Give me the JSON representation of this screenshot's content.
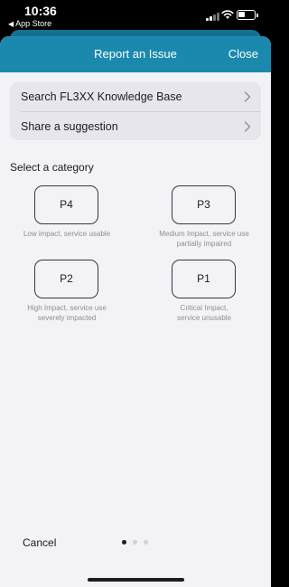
{
  "status_bar": {
    "time": "10:36",
    "back_app": "App Store",
    "icons": [
      "cellular-signal-icon",
      "wifi-icon",
      "battery-icon"
    ]
  },
  "nav": {
    "title": "Report an Issue",
    "close_label": "Close",
    "background_color": "#1a89ad"
  },
  "menu": {
    "items": [
      {
        "label": "Search FL3XX Knowledge Base",
        "icon": "chevron-right-icon"
      },
      {
        "label": "Share a suggestion",
        "icon": "chevron-right-icon"
      }
    ]
  },
  "category": {
    "heading": "Select a category",
    "options": [
      {
        "label": "P4",
        "description_line1": "Low impact, service usable",
        "description_line2": ""
      },
      {
        "label": "P3",
        "description_line1": "Medium Impact, service use",
        "description_line2": "partially impaired"
      },
      {
        "label": "P2",
        "description_line1": "High Impact, service use",
        "description_line2": "severely impacted"
      },
      {
        "label": "P1",
        "description_line1": "Critical Impact,",
        "description_line2": "service unusable"
      }
    ]
  },
  "footer": {
    "cancel_label": "Cancel",
    "page_indicator": {
      "total": 3,
      "current": 1
    }
  }
}
